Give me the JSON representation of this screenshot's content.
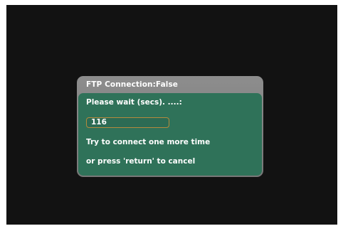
{
  "dialog": {
    "title": "FTP Connection:False",
    "wait_label": "Please wait (secs). ....:",
    "countdown_value": "116",
    "message_line1": "Try to connect one more time",
    "message_line2": "or press 'return' to cancel"
  },
  "colors": {
    "screen_background": "#121212",
    "dialog_frame": "#808080",
    "dialog_body": "#2f7259",
    "field_border": "#b48a3c",
    "text": "#ffffff"
  }
}
